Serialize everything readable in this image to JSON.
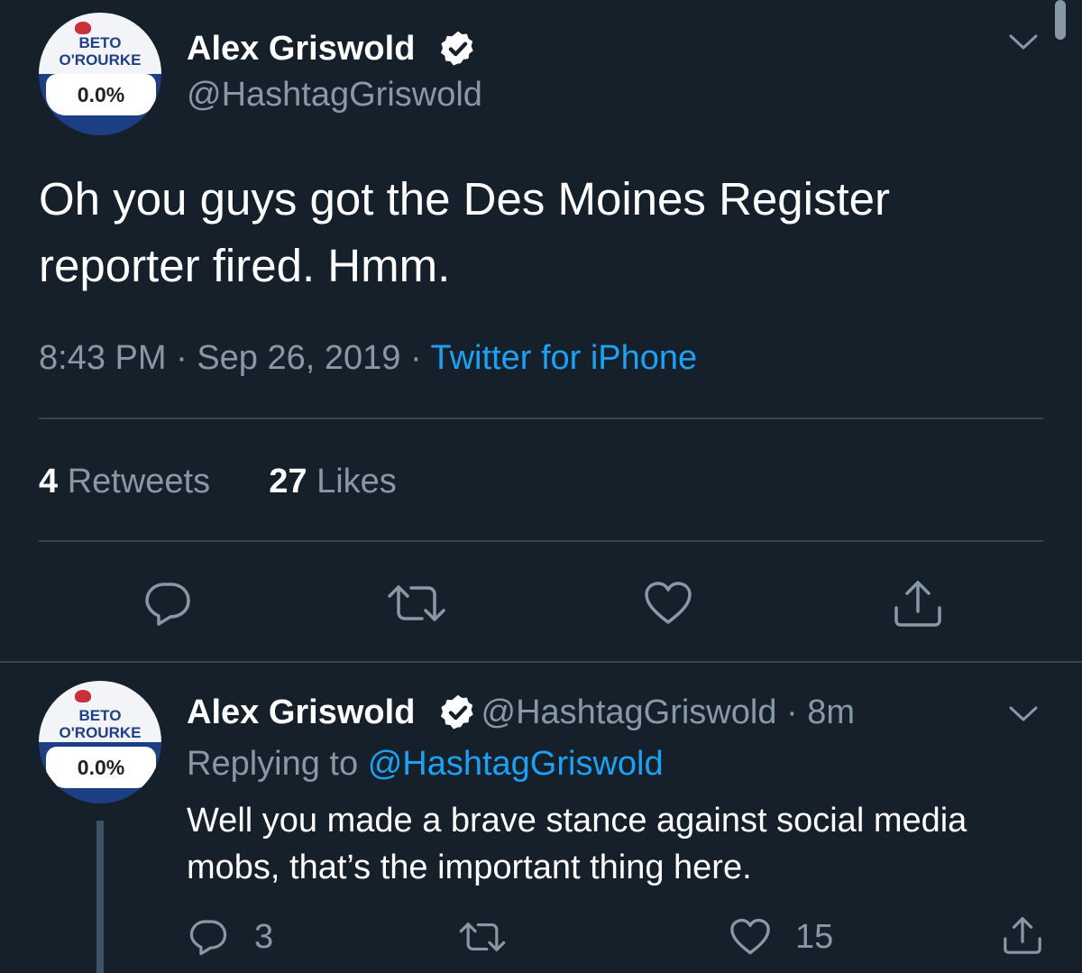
{
  "tweet": {
    "avatar": {
      "line1": "BETO",
      "line2": "O'ROURKE",
      "percent": "0.0%"
    },
    "name": "Alex Griswold",
    "handle": "@HashtagGriswold",
    "text_line1": "Oh you guys got the Des Moines Register",
    "text_line2": "reporter fired. Hmm.",
    "time": "8:43 PM",
    "date": "Sep 26, 2019",
    "source": "Twitter for iPhone",
    "separator": "·",
    "retweets_count": "4",
    "retweets_label": "Retweets",
    "likes_count": "27",
    "likes_label": "Likes"
  },
  "reply": {
    "avatar": {
      "line1": "BETO",
      "line2": "O'ROURKE",
      "percent": "0.0%"
    },
    "name": "Alex Griswold",
    "handle": "@HashtagGriswold",
    "separator": "·",
    "age": "8m",
    "replying_prefix": "Replying to",
    "replying_handle": "@HashtagGriswold",
    "text_line1": "Well you made a brave stance against social media",
    "text_line2": "mobs, that’s the important thing here.",
    "reply_count": "3",
    "like_count": "15"
  },
  "colors": {
    "background": "#15202b",
    "muted": "#8899a6",
    "link": "#1da1f2",
    "divider": "#38444d"
  }
}
